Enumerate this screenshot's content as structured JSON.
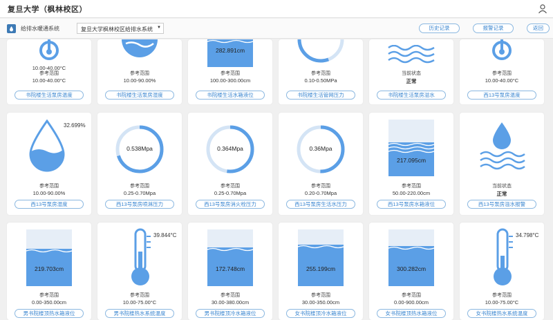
{
  "titlebar": {
    "title": "复旦大学（枫林校区）"
  },
  "toolbar": {
    "system_label": "给排水暖通系统",
    "system_select": "复旦大学枫林校区给排水系统",
    "btn_history": "历史记录",
    "btn_alarm": "报警记录",
    "btn_back": "返回"
  },
  "common": {
    "ref_range": "参考范围",
    "current_state": "当前状态"
  },
  "row1": [
    {
      "range": "10.00-40.00°C",
      "name": "书院楼生活泵房温度"
    },
    {
      "range": "10.00-90.00%",
      "name": "书院楼生活泵房湿度"
    },
    {
      "value": "282.891cm",
      "range": "100.00-300.00cm",
      "name": "书院楼生活水箱液位"
    },
    {
      "range": "0.10-0.50MPa",
      "name": "书院楼生活管网压力"
    },
    {
      "state": "正常",
      "name": "书院楼生活泵房溢水"
    },
    {
      "range": "10.00-40.00°C",
      "name": "西13号泵房温度"
    }
  ],
  "row2": [
    {
      "value": "32.699%",
      "range": "10.00-90.00%",
      "name": "西13号泵房湿度",
      "level": 0.33
    },
    {
      "value": "0.538Mpa",
      "range": "0.25-0.70Mpa",
      "name": "西13号泵房喷淋压力",
      "fraction": 0.7
    },
    {
      "value": "0.364Mpa",
      "range": "0.25-0.70Mpa",
      "name": "西13号泵房消火栓压力",
      "fraction": 0.52
    },
    {
      "value": "0.36Mpa",
      "range": "0.20-0.70Mpa",
      "name": "西13号泵房生活水压力",
      "fraction": 0.5
    },
    {
      "value": "217.095cm",
      "range": "50.00-220.00cm",
      "name": "西13号泵房水箱液位",
      "level": 0.6
    },
    {
      "state": "正常",
      "name": "西13号泵房溢水报警"
    }
  ],
  "row3": [
    {
      "value": "219.703cm",
      "range": "0.00-350.00cm",
      "name": "男书院楼顶热水箱液位",
      "level": 0.58
    },
    {
      "value": "39.844°C",
      "range": "10.00-75.00°C",
      "name": "男书院楼热水系统温度",
      "level": 0.46
    },
    {
      "value": "172.748cm",
      "range": "30.00-380.00cm",
      "name": "男书院楼顶冷水箱液位",
      "level": 0.5
    },
    {
      "value": "255.199cm",
      "range": "30.00-350.00cm",
      "name": "女书院楼顶冷水箱液位",
      "level": 0.65
    },
    {
      "value": "300.282cm",
      "range": "0.00-900.00cm",
      "name": "女书院楼顶热水箱液位",
      "level": 0.5
    },
    {
      "value": "34.798°C",
      "range": "10.00-75.00°C",
      "name": "女书院楼热水系统温度",
      "level": 0.38
    }
  ],
  "colors": {
    "accent": "#5b9fe6",
    "light": "#e6eef7",
    "track": "#d4e4f5",
    "button": "#3a86d0"
  }
}
